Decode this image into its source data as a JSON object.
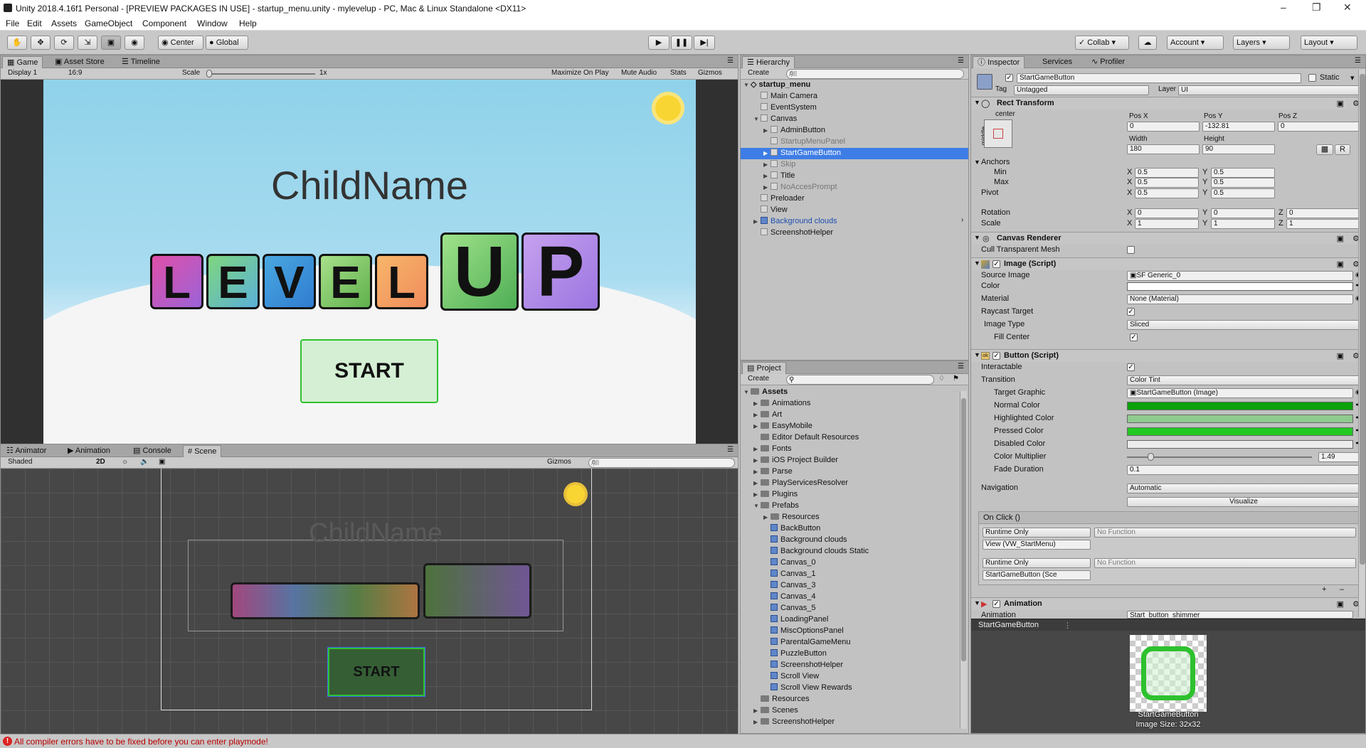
{
  "window": {
    "title": "Unity 2018.4.16f1 Personal - [PREVIEW PACKAGES IN USE] - startup_menu.unity - mylevelup - PC, Mac & Linux Standalone <DX11>"
  },
  "menu": [
    "File",
    "Edit",
    "Assets",
    "GameObject",
    "Component",
    "Window",
    "Help"
  ],
  "toolbar": {
    "center": "Center",
    "global": "Global",
    "collab": "Collab",
    "account": "Account",
    "layers": "Layers",
    "layout": "Layout"
  },
  "game": {
    "tabs": [
      "Game",
      "Asset Store",
      "Timeline"
    ],
    "display": "Display 1",
    "aspect": "16:9",
    "scale_label": "Scale",
    "scale_value": "1x",
    "maximize": "Maximize On Play",
    "mute": "Mute Audio",
    "stats": "Stats",
    "gizmos": "Gizmos",
    "child_name": "ChildName",
    "level_letters": [
      "L",
      "E",
      "V",
      "E",
      "L"
    ],
    "up_letters": [
      "U",
      "P"
    ],
    "start": "START"
  },
  "scene": {
    "tabs": [
      "Animator",
      "Animation",
      "Console",
      "Scene"
    ],
    "shading": "Shaded",
    "mode2d": "2D",
    "gizmos": "Gizmos",
    "search_placeholder": "All",
    "child_name": "ChildName",
    "start": "START"
  },
  "hierarchy": {
    "tab": "Hierarchy",
    "create": "Create",
    "search_placeholder": "All",
    "scene": "startup_menu",
    "items": [
      {
        "label": "Main Camera",
        "indent": 1,
        "arrow": false,
        "dim": false,
        "selected": false,
        "prefab": false
      },
      {
        "label": "EventSystem",
        "indent": 1,
        "arrow": false,
        "dim": false,
        "selected": false,
        "prefab": false
      },
      {
        "label": "Canvas",
        "indent": 1,
        "arrow": true,
        "dim": false,
        "selected": false,
        "prefab": false
      },
      {
        "label": "AdminButton",
        "indent": 2,
        "arrow": true,
        "dim": false,
        "selected": false,
        "prefab": false
      },
      {
        "label": "StartupMenuPanel",
        "indent": 2,
        "arrow": false,
        "dim": true,
        "selected": false,
        "prefab": false
      },
      {
        "label": "StartGameButton",
        "indent": 2,
        "arrow": true,
        "dim": false,
        "selected": true,
        "prefab": false
      },
      {
        "label": "Skip",
        "indent": 2,
        "arrow": true,
        "dim": true,
        "selected": false,
        "prefab": false
      },
      {
        "label": "Title",
        "indent": 2,
        "arrow": true,
        "dim": false,
        "selected": false,
        "prefab": false
      },
      {
        "label": "NoAccesPrompt",
        "indent": 2,
        "arrow": true,
        "dim": true,
        "selected": false,
        "prefab": false
      },
      {
        "label": "Preloader",
        "indent": 1,
        "arrow": false,
        "dim": false,
        "selected": false,
        "prefab": false
      },
      {
        "label": "View",
        "indent": 1,
        "arrow": false,
        "dim": false,
        "selected": false,
        "prefab": false
      },
      {
        "label": "Background clouds",
        "indent": 1,
        "arrow": true,
        "dim": false,
        "selected": false,
        "prefab": true
      },
      {
        "label": "ScreenshotHelper",
        "indent": 1,
        "arrow": false,
        "dim": false,
        "selected": false,
        "prefab": false
      }
    ]
  },
  "project": {
    "tab": "Project",
    "create": "Create",
    "root": "Assets",
    "items": [
      {
        "label": "Animations",
        "indent": 1,
        "type": "folder",
        "arrow": true
      },
      {
        "label": "Art",
        "indent": 1,
        "type": "folder",
        "arrow": true
      },
      {
        "label": "EasyMobile",
        "indent": 1,
        "type": "folder",
        "arrow": true
      },
      {
        "label": "Editor Default Resources",
        "indent": 1,
        "type": "folder",
        "arrow": false
      },
      {
        "label": "Fonts",
        "indent": 1,
        "type": "folder",
        "arrow": true
      },
      {
        "label": "iOS Project Builder",
        "indent": 1,
        "type": "folder",
        "arrow": true
      },
      {
        "label": "Parse",
        "indent": 1,
        "type": "folder",
        "arrow": true
      },
      {
        "label": "PlayServicesResolver",
        "indent": 1,
        "type": "folder",
        "arrow": true
      },
      {
        "label": "Plugins",
        "indent": 1,
        "type": "folder",
        "arrow": true
      },
      {
        "label": "Prefabs",
        "indent": 1,
        "type": "folder",
        "arrow": true
      },
      {
        "label": "Resources",
        "indent": 2,
        "type": "folder",
        "arrow": true
      },
      {
        "label": "BackButton",
        "indent": 2,
        "type": "prefab",
        "arrow": false
      },
      {
        "label": "Background clouds",
        "indent": 2,
        "type": "prefab",
        "arrow": false
      },
      {
        "label": "Background clouds Static",
        "indent": 2,
        "type": "prefab",
        "arrow": false
      },
      {
        "label": "Canvas_0",
        "indent": 2,
        "type": "prefab",
        "arrow": false
      },
      {
        "label": "Canvas_1",
        "indent": 2,
        "type": "prefab",
        "arrow": false
      },
      {
        "label": "Canvas_3",
        "indent": 2,
        "type": "prefab",
        "arrow": false
      },
      {
        "label": "Canvas_4",
        "indent": 2,
        "type": "prefab",
        "arrow": false
      },
      {
        "label": "Canvas_5",
        "indent": 2,
        "type": "prefab",
        "arrow": false
      },
      {
        "label": "LoadingPanel",
        "indent": 2,
        "type": "prefab",
        "arrow": false
      },
      {
        "label": "MiscOptionsPanel",
        "indent": 2,
        "type": "prefab",
        "arrow": false
      },
      {
        "label": "ParentalGameMenu",
        "indent": 2,
        "type": "prefab",
        "arrow": false
      },
      {
        "label": "PuzzleButton",
        "indent": 2,
        "type": "prefab",
        "arrow": false
      },
      {
        "label": "ScreenshotHelper",
        "indent": 2,
        "type": "prefab",
        "arrow": false
      },
      {
        "label": "Scroll View",
        "indent": 2,
        "type": "prefab",
        "arrow": false
      },
      {
        "label": "Scroll View Rewards",
        "indent": 2,
        "type": "prefab",
        "arrow": false
      },
      {
        "label": "Resources",
        "indent": 1,
        "type": "folder",
        "arrow": false
      },
      {
        "label": "Scenes",
        "indent": 1,
        "type": "folder",
        "arrow": true
      },
      {
        "label": "ScreenshotHelper",
        "indent": 1,
        "type": "folder",
        "arrow": true
      }
    ]
  },
  "inspector": {
    "tabs": [
      "Inspector",
      "Services",
      "Profiler"
    ],
    "object_name": "StartGameButton",
    "static": "Static",
    "tag_label": "Tag",
    "tag": "Untagged",
    "layer_label": "Layer",
    "layer": "UI",
    "rect": {
      "title": "Rect Transform",
      "anchor_h": "center",
      "anchor_v": "middle",
      "posx_l": "Pos X",
      "posy_l": "Pos Y",
      "posz_l": "Pos Z",
      "posx": "0",
      "posy": "-132.81",
      "posz": "0",
      "width_l": "Width",
      "height_l": "Height",
      "width": "180",
      "height": "90",
      "r_btn": "R",
      "anchors": "Anchors",
      "min": "Min",
      "max": "Max",
      "pivot": "Pivot",
      "rotation": "Rotation",
      "scale": "Scale",
      "min_x": "0.5",
      "min_y": "0.5",
      "max_x": "0.5",
      "max_y": "0.5",
      "pivot_x": "0.5",
      "pivot_y": "0.5",
      "rot_x": "0",
      "rot_y": "0",
      "rot_z": "0",
      "scale_x": "1",
      "scale_y": "1",
      "scale_z": "1"
    },
    "canvas_renderer": {
      "title": "Canvas Renderer",
      "cull": "Cull Transparent Mesh"
    },
    "image": {
      "title": "Image (Script)",
      "source_l": "Source Image",
      "source": "SF Generic_0",
      "color_l": "Color",
      "material_l": "Material",
      "material": "None (Material)",
      "raycast_l": "Raycast Target",
      "type_l": "Image Type",
      "type": "Sliced",
      "fill_l": "Fill Center"
    },
    "button": {
      "title": "Button (Script)",
      "interactable_l": "Interactable",
      "transition_l": "Transition",
      "transition": "Color Tint",
      "target_l": "Target Graphic",
      "target": "StartGameButton (Image)",
      "normal_l": "Normal Color",
      "highlighted_l": "Highlighted Color",
      "pressed_l": "Pressed Color",
      "disabled_l": "Disabled Color",
      "multiplier_l": "Color Multiplier",
      "multiplier": "1.49",
      "fade_l": "Fade Duration",
      "fade": "0.1",
      "nav_l": "Navigation",
      "nav": "Automatic",
      "visualize": "Visualize",
      "onclick": "On Click ()",
      "runtime1": "Runtime Only",
      "nofunc1": "No Function",
      "obj1": "View (VW_StartMenu)",
      "runtime2": "Runtime Only",
      "nofunc2": "No Function",
      "obj2": "StartGameButton (Sce"
    },
    "animation": {
      "title": "Animation",
      "anim_l": "Animation",
      "anim": "Start_button_shimmer"
    },
    "preview_title": "StartGameButton",
    "preview_label": "StartGameButton",
    "preview_size": "Image Size: 32x32",
    "colors": {
      "normal": "#0aa10a",
      "highlighted": "#8fca8f",
      "pressed": "#22c922",
      "disabled": "#ededed"
    }
  },
  "status": {
    "message": "All compiler errors have to be fixed before you can enter playmode!"
  }
}
